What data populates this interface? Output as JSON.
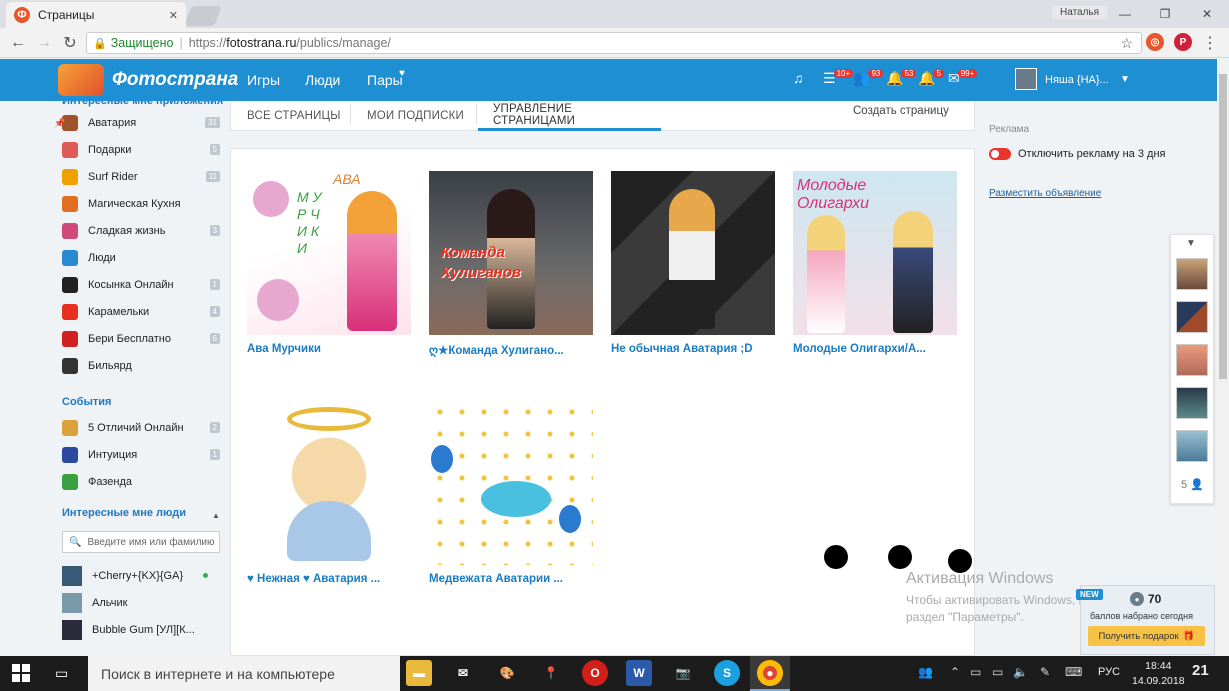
{
  "browser": {
    "tab_title": "Страницы",
    "window_user": "Наталья",
    "secure_label": "Защищено",
    "url_scheme": "https://",
    "url_host": "fotostrana.ru",
    "url_path": "/publics/manage/"
  },
  "header": {
    "logo": "Фотострана",
    "nav": [
      "Игры",
      "Люди",
      "Пары"
    ],
    "badges": [
      "10+",
      "93",
      "53",
      "5",
      "99+"
    ],
    "user": "Няша {НА}..."
  },
  "sidebar": {
    "cut_header": "Интересные мне приложения",
    "apps": [
      {
        "name": "Аватария",
        "count": "31",
        "color": "#a0522d"
      },
      {
        "name": "Подарки",
        "count": "5",
        "color": "#e05a5a"
      },
      {
        "name": "Surf Rider",
        "count": "11",
        "color": "#f0a000"
      },
      {
        "name": "Магическая Кухня",
        "count": "",
        "color": "#e07020"
      },
      {
        "name": "Сладкая жизнь",
        "count": "3",
        "color": "#d04a7a"
      },
      {
        "name": "Люди",
        "count": "",
        "color": "#2a8ad0"
      },
      {
        "name": "Косынка Онлайн",
        "count": "1",
        "color": "#222222"
      },
      {
        "name": "Карамельки",
        "count": "4",
        "color": "#e83020"
      },
      {
        "name": "Бери Бесплатно",
        "count": "6",
        "color": "#d02020"
      },
      {
        "name": "Бильярд",
        "count": "",
        "color": "#333333"
      }
    ],
    "events_header": "События",
    "events": [
      {
        "name": "5 Отличий Онлайн",
        "count": "2",
        "color": "#d9a23a"
      },
      {
        "name": "Интуиция",
        "count": "1",
        "color": "#2a4aa0"
      },
      {
        "name": "Фазенда",
        "count": "",
        "color": "#3aa040"
      }
    ],
    "people_header": "Интересные мне люди",
    "people_search_placeholder": "Введите имя или фамилию",
    "people": [
      {
        "name": "+Cherry+{KX}{GA}",
        "color": "#3a5a7a"
      },
      {
        "name": "Альчик",
        "color": "#7a9aaa"
      },
      {
        "name": "Bubble Gum [УЛ][К...",
        "color": "#2a2a3a"
      }
    ]
  },
  "tabs": {
    "all": "ВСЕ СТРАНИЦЫ",
    "subs": "МОИ ПОДПИСКИ",
    "manage": "УПРАВЛЕНИЕ СТРАНИЦАМИ",
    "create": "Создать страницу"
  },
  "cards": [
    {
      "title": "Ава Мурчики"
    },
    {
      "title": "ღ★Команда Хулигано..."
    },
    {
      "title": "Не обычная Аватария ;D"
    },
    {
      "title": "Молодые Олигархи/А..."
    },
    {
      "title": "♥ Нежная ♥ Аватария ..."
    },
    {
      "title": "Медвежата Аватарии ..."
    }
  ],
  "card_captions": {
    "ava": "АВА",
    "murchiki": "М У Р Ч И К И",
    "hooligans": "Команда Хулиганов",
    "oligarchs": "Молодые Олигархи"
  },
  "right": {
    "ad_label": "Реклама",
    "ad_off": "Отключить рекламу на 3 дня",
    "place_ad": "Разместить объявление",
    "mini_count": "5"
  },
  "activation": {
    "line1": "Активация Windows",
    "line2": "Чтобы активировать Windows, перейдите в",
    "line3": "раздел \"Параметры\"."
  },
  "bonus": {
    "new": "NEW",
    "points": "70",
    "label": "баллов набрано сегодня",
    "button": "Получить подарок"
  },
  "taskbar": {
    "search": "Поиск в интернете и на компьютере",
    "lang": "РУС",
    "time": "18:44",
    "date": "14.09.2018",
    "notif_count": "21"
  }
}
